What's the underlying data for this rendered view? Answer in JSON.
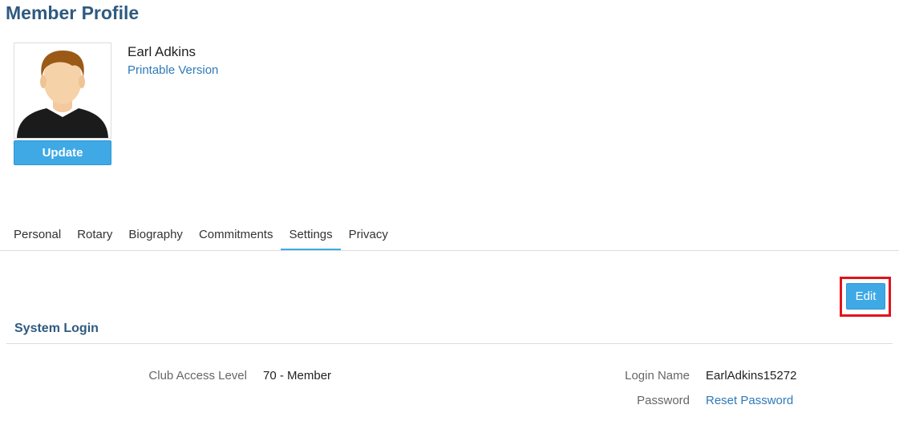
{
  "page": {
    "title": "Member Profile"
  },
  "member": {
    "name": "Earl Adkins",
    "printable_label": "Printable Version",
    "update_label": "Update"
  },
  "tabs": [
    {
      "label": "Personal"
    },
    {
      "label": "Rotary"
    },
    {
      "label": "Biography"
    },
    {
      "label": "Commitments"
    },
    {
      "label": "Settings"
    },
    {
      "label": "Privacy"
    }
  ],
  "active_tab": "Settings",
  "toolbar": {
    "edit_label": "Edit"
  },
  "system_login": {
    "heading": "System Login",
    "club_access_level_label": "Club Access Level",
    "club_access_level_value": "70 - Member",
    "login_name_label": "Login Name",
    "login_name_value": "EarlAdkins15272",
    "password_label": "Password",
    "password_link": "Reset Password"
  },
  "colors": {
    "title": "#2f5a80",
    "accent": "#3fa9e6",
    "link": "#2e7ab8",
    "highlight": "#e0141c"
  }
}
